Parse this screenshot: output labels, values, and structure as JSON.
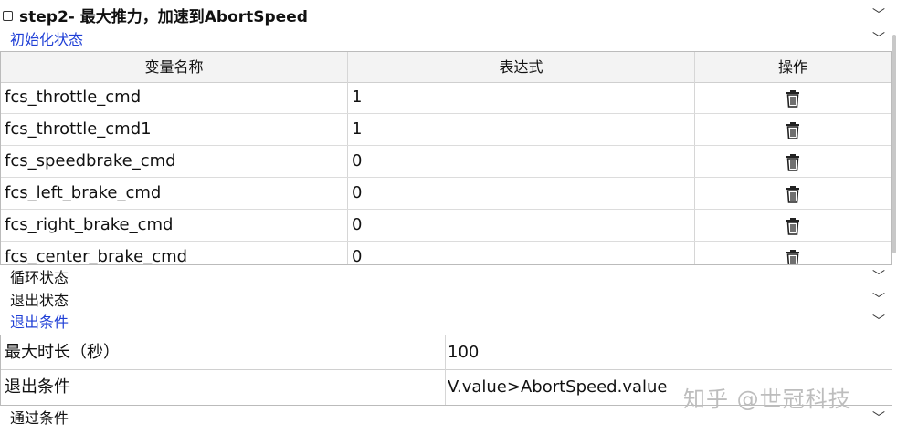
{
  "step": {
    "title": "step2- 最大推力，加速到AbortSpeed"
  },
  "init_section": {
    "label": "初始化状态",
    "columns": [
      "变量名称",
      "表达式",
      "操作"
    ],
    "rows": [
      {
        "name": "fcs_throttle_cmd",
        "expr": "1"
      },
      {
        "name": "fcs_throttle_cmd1",
        "expr": "1"
      },
      {
        "name": "fcs_speedbrake_cmd",
        "expr": "0"
      },
      {
        "name": "fcs_left_brake_cmd",
        "expr": "0"
      },
      {
        "name": "fcs_right_brake_cmd",
        "expr": "0"
      },
      {
        "name": "fcs_center_brake_cmd",
        "expr": "0"
      }
    ],
    "action_icon": "trash-icon"
  },
  "loop_section": {
    "label": "循环状态"
  },
  "exit_state_section": {
    "label": "退出状态"
  },
  "exit_condition_section": {
    "label": "退出条件",
    "rows": [
      {
        "key": "最大时长（秒）",
        "value": "100"
      },
      {
        "key": "退出条件",
        "value": "V.value>AbortSpeed.value"
      }
    ]
  },
  "pass_section": {
    "label": "通过条件"
  },
  "watermark": "知乎 @世冠科技",
  "colors": {
    "accent_blue": "#1f3fd6",
    "header_bg": "#f3f3f3",
    "border": "#bbbbbb"
  }
}
